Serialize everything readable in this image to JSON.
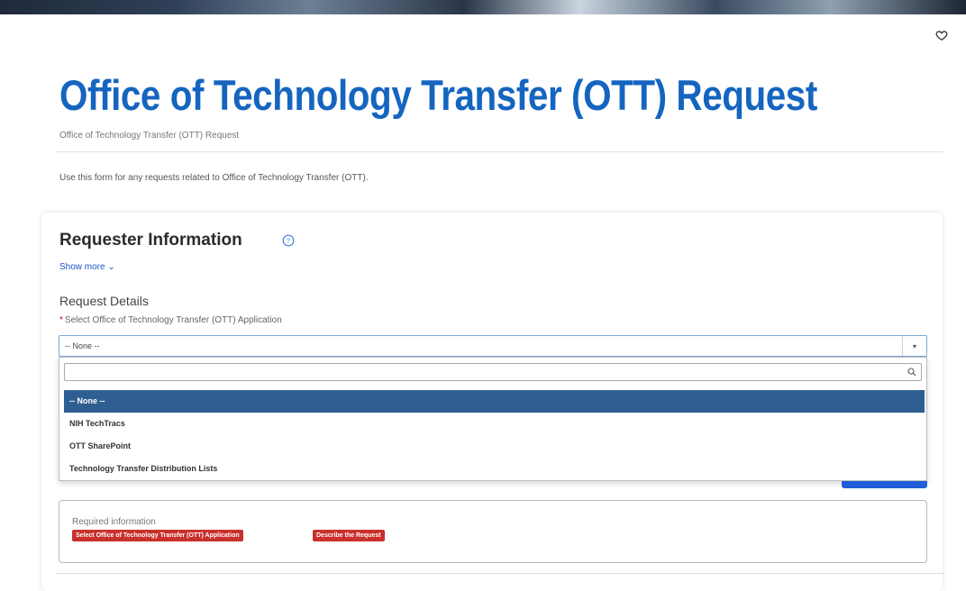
{
  "header": {
    "title": "Office of Technology Transfer (OTT) Request",
    "breadcrumb": "Office of Technology Transfer (OTT) Request",
    "intro": "Use this form for any requests related to Office of Technology Transfer (OTT)."
  },
  "icons": {
    "favorite": "heart-icon",
    "help": "help-icon",
    "search": "search-icon",
    "dropdown": "chevron-down-icon"
  },
  "form": {
    "section_title": "Requester Information",
    "show_more": "Show more ⌄",
    "request_details": "Request Details",
    "field_label": "Select Office of Technology Transfer (OTT) Application",
    "select_value": "-- None --",
    "search_placeholder": "",
    "options": [
      {
        "label": "-- None --",
        "selected": true
      },
      {
        "label": "NIH TechTracs",
        "selected": false
      },
      {
        "label": "OTT SharePoint",
        "selected": false
      },
      {
        "label": "Technology Transfer Distribution Lists",
        "selected": false
      }
    ]
  },
  "required_info": {
    "title": "Required information",
    "badges": [
      "Select Office of Technology Transfer (OTT) Application",
      "Describe the Request"
    ]
  },
  "colors": {
    "title_blue": "#1565c0",
    "selected_option": "#2f5f92",
    "badge_red": "#c9302c",
    "link_blue": "#1a56c9"
  }
}
